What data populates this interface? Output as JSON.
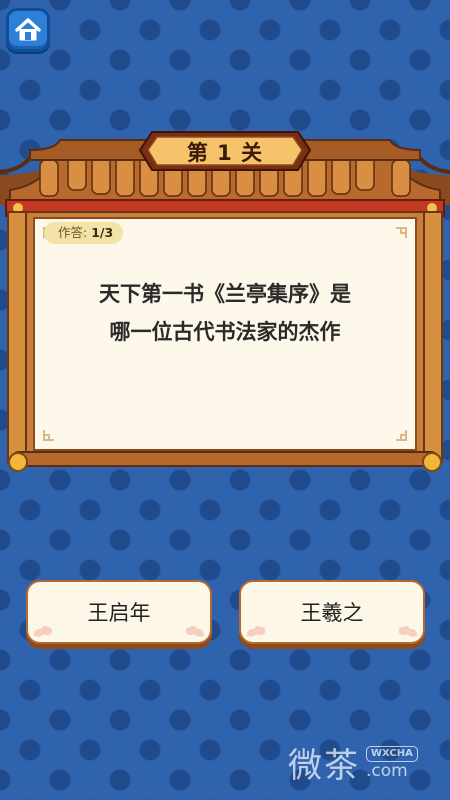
{
  "header": {
    "home_icon": "home-icon"
  },
  "level": {
    "title": "第 1 关"
  },
  "progress": {
    "label": "作答:",
    "value": "1/3"
  },
  "question": {
    "line1": "天下第一书《兰亭集序》是",
    "line2": "哪一位古代书法家的杰作"
  },
  "answers": [
    {
      "label": "王启年"
    },
    {
      "label": "王羲之"
    }
  ],
  "watermark": {
    "cn": "微茶",
    "en": "WXCHA",
    "com": ".com"
  },
  "colors": {
    "background": "#2f63ad",
    "wood": "#c97f3b",
    "paper": "#fdf8ea",
    "red": "#c23a23"
  }
}
